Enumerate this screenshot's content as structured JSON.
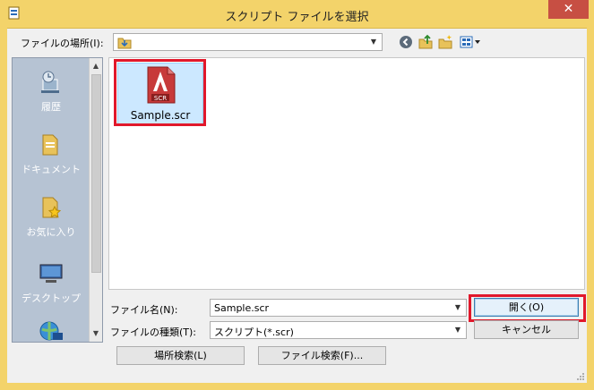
{
  "window": {
    "title": "スクリプト ファイルを選択",
    "close_glyph": "✕"
  },
  "location": {
    "label": "ファイルの場所(I):",
    "value": ""
  },
  "toolbar": {
    "icons": [
      "back-icon",
      "up-folder-icon",
      "new-folder-icon",
      "view-menu-icon"
    ]
  },
  "places": [
    {
      "label": "履歴",
      "icon": "history-icon"
    },
    {
      "label": "ドキュメント",
      "icon": "documents-folder-icon"
    },
    {
      "label": "お気に入り",
      "icon": "favorites-icon"
    },
    {
      "label": "デスクトップ",
      "icon": "desktop-icon"
    },
    {
      "label": "",
      "icon": "network-icon"
    }
  ],
  "files": [
    {
      "name": "Sample.scr",
      "icon_text": "SCR",
      "selected": true
    }
  ],
  "filename": {
    "label": "ファイル名(N):",
    "value": "Sample.scr"
  },
  "filetype": {
    "label": "ファイルの種類(T):",
    "value": "スクリプト(*.scr)"
  },
  "buttons": {
    "open": "開く(O)",
    "cancel": "キャンセル",
    "place_search": "場所検索(L)",
    "file_search": "ファイル検索(F)..."
  },
  "colors": {
    "title_bar": "#f3d36a",
    "close": "#c74f43",
    "highlight": "#e1182b",
    "places_bg": "#b6c3d3",
    "selection": "#cce8ff"
  }
}
